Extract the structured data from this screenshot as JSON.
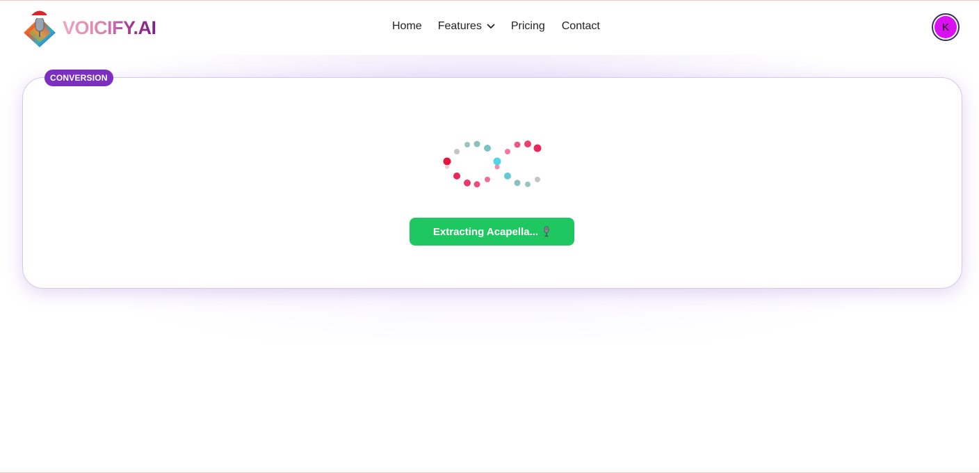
{
  "header": {
    "brand": "VOICIFY.AI",
    "logo_icon": "microphone-logo-icon",
    "nav": {
      "home": "Home",
      "features": "Features",
      "pricing": "Pricing",
      "contact": "Contact"
    },
    "avatar_initial": "K"
  },
  "conversion": {
    "badge": "CONVERSION",
    "loader_icon": "infinity-dots-loader-icon",
    "status_text": "Extracting Acapella...",
    "status_icon": "microphone-icon"
  },
  "colors": {
    "accent_green": "#1fc760",
    "badge_purple": "#7a2fbe",
    "avatar_magenta": "#d911f0"
  }
}
